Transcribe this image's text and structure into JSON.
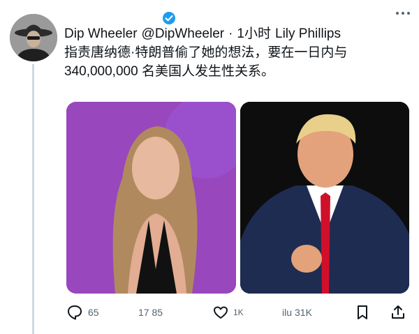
{
  "tweet": {
    "author_name": "Dip Wheeler",
    "author_handle": "@DipWheeler",
    "separator": "·",
    "time": "1小时",
    "text_line1_tail": "Lily Phillips",
    "text_line2": "指责唐纳德·特朗普偷了她的想法，要在一日内与",
    "text_line3": "340,000,000 名美国人发生性关系。"
  },
  "actions": {
    "replies": "65",
    "retweets": "17 85",
    "likes": "1K",
    "views_prefix": "ilu",
    "views": "31K"
  },
  "icons": {
    "verified": "verified-badge-icon",
    "more": "more-options-icon",
    "reply": "reply-icon",
    "like": "heart-icon",
    "bookmark": "bookmark-icon",
    "share": "share-icon"
  },
  "colors": {
    "verified_blue": "#1d9bf0",
    "text": "#0f1419",
    "secondary": "#536471"
  }
}
